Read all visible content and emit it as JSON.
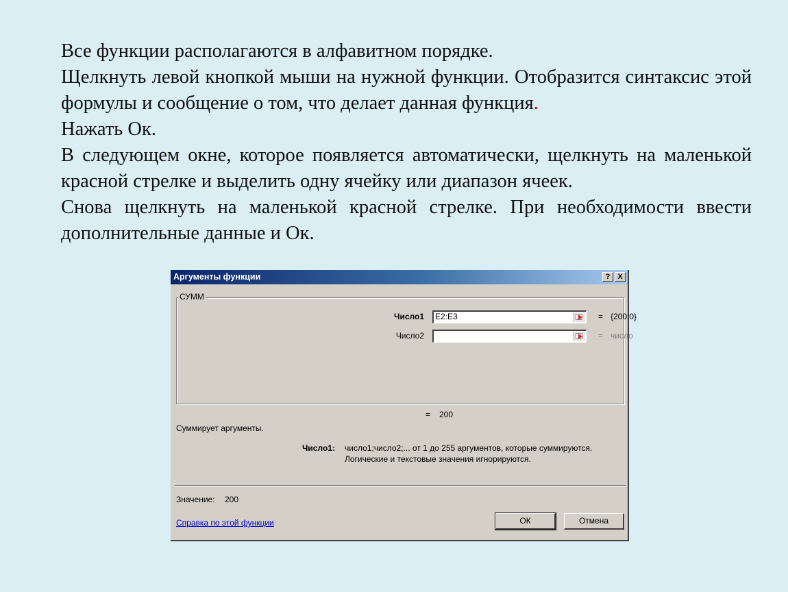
{
  "slide": {
    "para1": "Все функции располагаются в алфавитном порядке.",
    "para2_main": "Щелкнуть левой кнопкой мыши на нужной функции. Отобразится синтаксис этой формулы  и сообщение о том, что делает данная функция",
    "para2_dot": ".",
    "para3": "Нажать Ок.",
    "para4": "В следующем окне, которое появляется автоматически, щелкнуть на маленькой красной стрелке и выделить одну ячейку или диапазон ячеек.",
    "para5": "Снова щелкнуть на маленькой красной стрелке. При необходимости ввести дополнительные данные  и  Ок."
  },
  "dialog": {
    "title": "Аргументы функции",
    "help_button": "?",
    "close_button": "X",
    "function_name": "СУММ",
    "args": [
      {
        "label": "Число1",
        "value": "E2:E3",
        "result": "{200:0}"
      },
      {
        "label": "Число2",
        "value": "",
        "result": "число"
      }
    ],
    "equals": "=",
    "formula_result": "200",
    "description": "Суммирует аргументы.",
    "arg_help_label": "Число1:",
    "arg_help_line1": "число1;число2;... от 1 до 255 аргументов, которые суммируются.",
    "arg_help_line2": "Логические и текстовые значения игнорируются.",
    "value_label": "Значение:",
    "value": "200",
    "help_link": "Справка по этой функции",
    "ok_label": "ОК",
    "cancel_label": "Отмена"
  },
  "colors": {
    "background": "#daeef3",
    "dialog_face": "#d4d0c8",
    "title_bar": "#0a246a",
    "red_accent": "#c00000",
    "link": "#0000cc"
  }
}
